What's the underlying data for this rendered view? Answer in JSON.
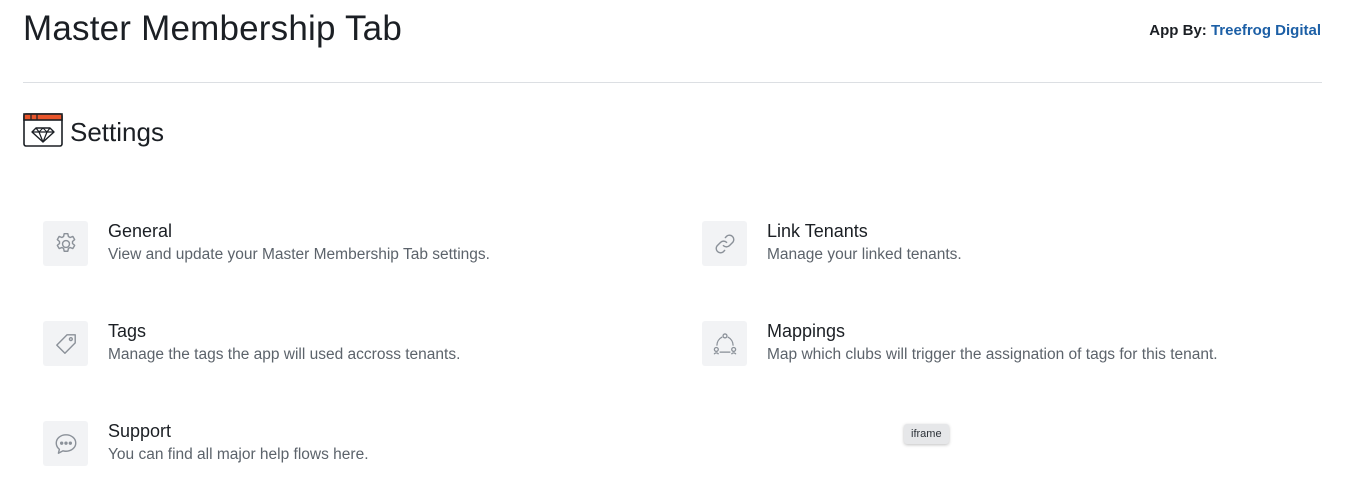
{
  "header": {
    "title": "Master Membership Tab",
    "app_by_label": "App By:",
    "app_by_link": "Treefrog Digital"
  },
  "section": {
    "title": "Settings",
    "icon": "browser-diamond-icon"
  },
  "cards": [
    {
      "title": "General",
      "description": "View and update your Master Membership Tab settings.",
      "icon": "gear-icon"
    },
    {
      "title": "Link Tenants",
      "description": "Manage your linked tenants.",
      "icon": "link-icon"
    },
    {
      "title": "Tags",
      "description": "Manage the tags the app will used accross tenants.",
      "icon": "tag-icon"
    },
    {
      "title": "Mappings",
      "description": "Map which clubs will trigger the assignation of tags for this tenant.",
      "icon": "network-icon"
    },
    {
      "title": "Support",
      "description": "You can find all major help flows here.",
      "icon": "chat-bubble-icon"
    }
  ],
  "tooltip": {
    "text": "iframe"
  },
  "colors": {
    "link": "#1c5fa6",
    "icon_bg": "#f2f3f5",
    "icon_stroke": "#8b9199",
    "accent_orange": "#e8552b"
  }
}
